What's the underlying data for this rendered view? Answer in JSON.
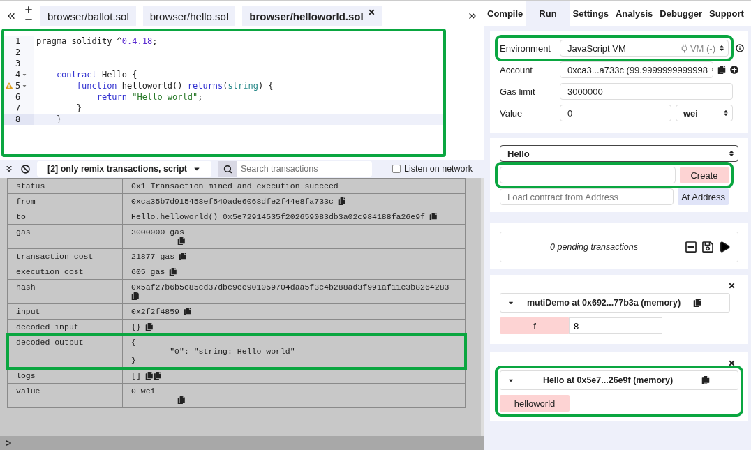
{
  "file_tabs": [
    {
      "label": "browser/ballot.sol",
      "selected": false
    },
    {
      "label": "browser/hello.sol",
      "selected": false
    },
    {
      "label": "browser/helloworld.sol",
      "selected": true
    }
  ],
  "editor": {
    "highlighted": true,
    "lines": [
      {
        "number": "1",
        "fold": false,
        "warning": false,
        "active": false,
        "tokens": [
          {
            "kind": "plain",
            "text": "pragma solidity ^"
          },
          {
            "kind": "number",
            "text": "0.4.18"
          },
          {
            "kind": "plain",
            "text": ";"
          }
        ]
      },
      {
        "number": "2",
        "fold": false,
        "warning": false,
        "active": false
      },
      {
        "number": "3",
        "fold": false,
        "warning": false,
        "active": false
      },
      {
        "number": "4",
        "fold": true,
        "warning": false,
        "active": false,
        "tokens": [
          {
            "kind": "keyword",
            "text": "    contract"
          },
          {
            "kind": "plain",
            "text": " Hello {"
          }
        ]
      },
      {
        "number": "5",
        "fold": true,
        "warning": true,
        "active": false,
        "tokens": [
          {
            "kind": "keyword",
            "text": "        function"
          },
          {
            "kind": "plain",
            "text": " helloworld() "
          },
          {
            "kind": "keyword",
            "text": "returns"
          },
          {
            "kind": "plain",
            "text": "("
          },
          {
            "kind": "type",
            "text": "string"
          },
          {
            "kind": "plain",
            "text": ") {"
          }
        ]
      },
      {
        "number": "6",
        "fold": false,
        "warning": false,
        "active": false,
        "tokens": [
          {
            "kind": "keyword",
            "text": "            return"
          },
          {
            "kind": "string",
            "text": " \"Hello world\""
          },
          {
            "kind": "plain",
            "text": ";"
          }
        ]
      },
      {
        "number": "7",
        "fold": false,
        "warning": false,
        "active": false,
        "tokens": [
          {
            "kind": "plain",
            "text": "        }"
          }
        ]
      },
      {
        "number": "8",
        "fold": false,
        "warning": false,
        "active": true,
        "tokens": [
          {
            "kind": "plain",
            "text": "    }"
          }
        ]
      }
    ]
  },
  "terminal": {
    "filter": "[2] only remix transactions, script",
    "search_placeholder": "Search transactions",
    "listen": {
      "label": "Listen on network",
      "checked": false
    },
    "rows": [
      {
        "key": "status",
        "value": "0x1 Transaction mined and execution succeed",
        "kind": "plain",
        "highlighted": false
      },
      {
        "key": "from",
        "value": "0xca35b7d915458ef540ade6068dfe2f44e8fa733c",
        "kind": "inline",
        "highlighted": false
      },
      {
        "key": "to",
        "value": "Hello.helloworld() 0x5e72914535f202659083db3a02c984188fa26e9f",
        "kind": "inline",
        "highlighted": false
      },
      {
        "key": "gas",
        "value": "3000000 gas",
        "kind": "below",
        "highlighted": false
      },
      {
        "key": "transaction cost",
        "value": "21877 gas",
        "kind": "inline",
        "highlighted": false
      },
      {
        "key": "execution cost",
        "value": "605 gas",
        "kind": "inline",
        "highlighted": false
      },
      {
        "key": "hash",
        "value": "0x5af27b6b5c85cd37dbc9ee901059704daa5f3c4b288ad3f991af11e3b8264283",
        "kind": "start",
        "highlighted": false
      },
      {
        "key": "input",
        "value": "0x2f2f4859",
        "kind": "inline",
        "highlighted": false
      },
      {
        "key": "decoded input",
        "value": "{}",
        "kind": "inline",
        "highlighted": false
      },
      {
        "key": "decoded output",
        "value": "{\n        \"0\": \"string: Hello world\"\n}",
        "kind": "plain",
        "highlighted": true
      },
      {
        "key": "logs",
        "value": "[]",
        "kind": "double",
        "highlighted": false
      },
      {
        "key": "value",
        "value": "0 wei",
        "kind": "below",
        "highlighted": false
      }
    ],
    "prompt": ">"
  },
  "panel_tabs": [
    {
      "label": "Compile",
      "selected": false
    },
    {
      "label": "Run",
      "selected": true
    },
    {
      "label": "Settings",
      "selected": false
    },
    {
      "label": "Analysis",
      "selected": false
    },
    {
      "label": "Debugger",
      "selected": false
    },
    {
      "label": "Support",
      "selected": false
    }
  ],
  "run": {
    "environment": {
      "label": "Environment",
      "value": "JavaScript VM",
      "network": "VM (-)",
      "highlighted": true
    },
    "account": {
      "label": "Account",
      "value": "0xca3...a733c (99.9999999999998"
    },
    "gas_limit": {
      "label": "Gas limit",
      "value": "3000000"
    },
    "value": {
      "label": "Value",
      "value": "0",
      "unit": "wei"
    },
    "contract": "Hello",
    "create": {
      "button": "Create",
      "highlighted": true
    },
    "at_address": {
      "placeholder": "Load contract from Address",
      "button": "At Address"
    },
    "pending": "0 pending transactions",
    "instances": [
      {
        "title": "mutiDemo at 0x692...77b3a (memory)",
        "highlighted": false,
        "functions": [
          {
            "label": "f",
            "value": "8",
            "kind": "input"
          }
        ]
      },
      {
        "title": "Hello at 0x5e7...26e9f (memory)",
        "highlighted": true,
        "functions": [
          {
            "label": "helloworld",
            "kind": "plain"
          }
        ]
      }
    ]
  }
}
